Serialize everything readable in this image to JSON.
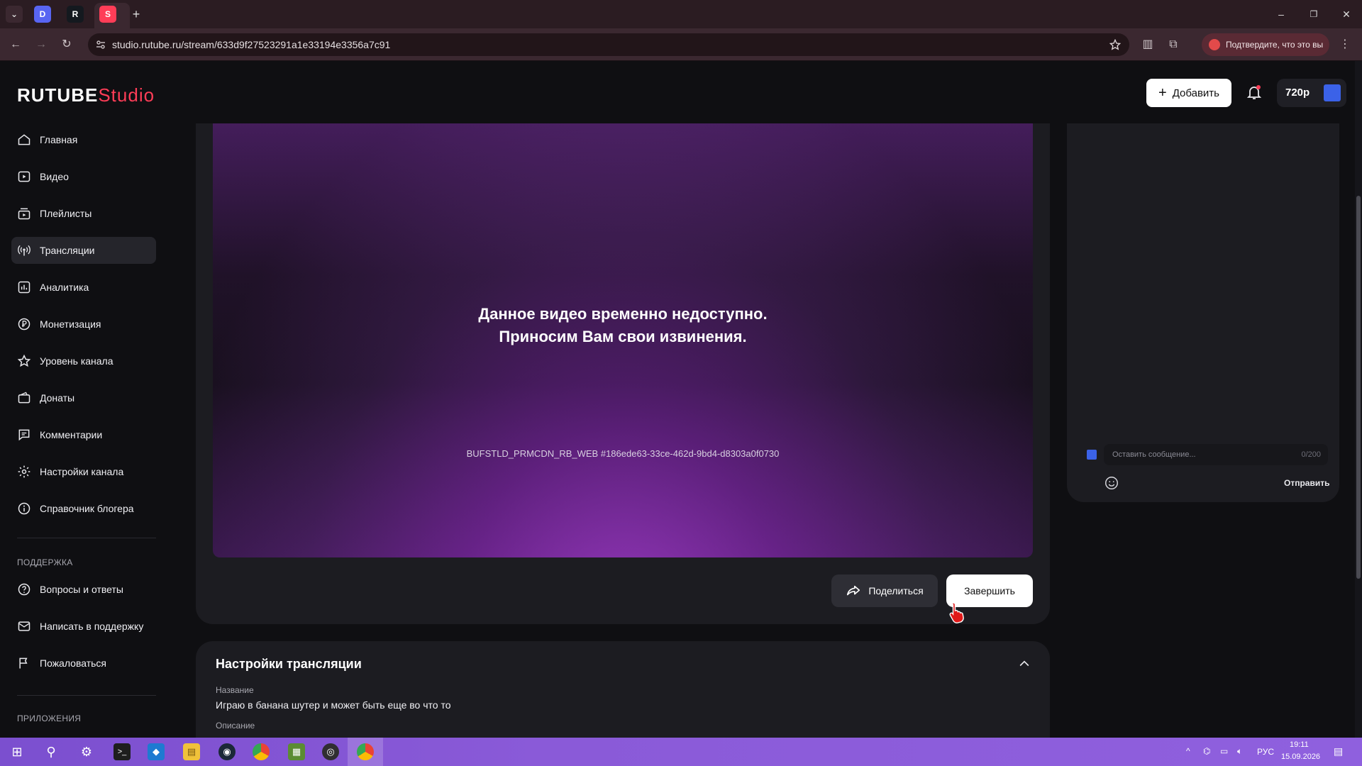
{
  "browser": {
    "url": "studio.rutube.ru/stream/633d9f27523291a1e33194e3356a7c91",
    "confirm_text": "Подтвердите, что это вы",
    "tabs": [
      {
        "icon": "D"
      },
      {
        "icon": "R"
      },
      {
        "icon": "S"
      }
    ]
  },
  "header": {
    "logo_main": "RUTUBE",
    "logo_studio": "Studio",
    "add_label": "Добавить",
    "quality": "720p"
  },
  "sidebar": {
    "items": [
      {
        "label": "Главная"
      },
      {
        "label": "Видео"
      },
      {
        "label": "Плейлисты"
      },
      {
        "label": "Трансляции"
      },
      {
        "label": "Аналитика"
      },
      {
        "label": "Монетизация"
      },
      {
        "label": "Уровень канала"
      },
      {
        "label": "Донаты"
      },
      {
        "label": "Комментарии"
      },
      {
        "label": "Настройки канала"
      },
      {
        "label": "Справочник блогера"
      }
    ],
    "support_title": "ПОДДЕРЖКА",
    "support_items": [
      {
        "label": "Вопросы и ответы"
      },
      {
        "label": "Написать в поддержку"
      },
      {
        "label": "Пожаловаться"
      }
    ],
    "apps_title": "ПРИЛОЖЕНИЯ"
  },
  "player": {
    "message_line1": "Данное видео временно недоступно.",
    "message_line2": "Приносим Вам свои извинения.",
    "error_code": "BUFSTLD_PRMCDN_RB_WEB #186ede63-33ce-462d-9bd4-d8303a0f0730",
    "share_label": "Поделиться",
    "finish_label": "Завершить"
  },
  "settings": {
    "title": "Настройки трансляции",
    "name_label": "Название",
    "name_value": "Играю в банана шутер и может быть еще во что то",
    "description_label": "Описание"
  },
  "chat": {
    "placeholder": "Оставить сообщение...",
    "counter": "0/200",
    "send_label": "Отправить"
  },
  "taskbar": {
    "lang": "РУС",
    "time": "19:11",
    "date": "15.09.2026"
  }
}
